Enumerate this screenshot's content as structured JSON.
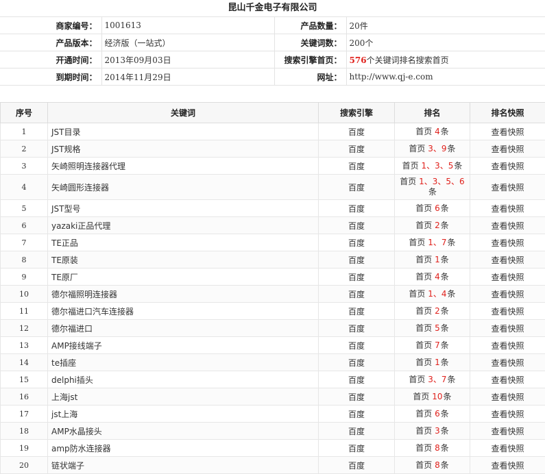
{
  "company": "昆山千金电子有限公司",
  "info": {
    "merchant_no_label": "商家编号：",
    "merchant_no": "1001613",
    "product_qty_label": "产品数量：",
    "product_qty": "20件",
    "version_label": "产品版本：",
    "version": "经济版（一站式）",
    "keyword_count_label": "关键词数：",
    "keyword_count": "200个",
    "open_label": "开通时间：",
    "open_date": "2013年09月03日",
    "search_label": "搜索引擎首页：",
    "search_count": "576",
    "search_suffix": "个关键词排名搜索首页",
    "expire_label": "到期时间：",
    "expire_date": "2014年11月29日",
    "url_label": "网址：",
    "url": "http://www.qj-e.com"
  },
  "table": {
    "headers": [
      "序号",
      "关键词",
      "搜索引擎",
      "排名",
      "排名快照"
    ],
    "rows": [
      {
        "no": "1",
        "keyword": "JST目录",
        "engine": "百度",
        "rank_prefix": "首页",
        "rank_nums": "4",
        "rank_suffix": "条",
        "snapshot": "查看快照"
      },
      {
        "no": "2",
        "keyword": "JST规格",
        "engine": "百度",
        "rank_prefix": "首页",
        "rank_nums": "3、9",
        "rank_suffix": "条",
        "snapshot": "查看快照"
      },
      {
        "no": "3",
        "keyword": "矢崎照明连接器代理",
        "engine": "百度",
        "rank_prefix": "首页",
        "rank_nums": "1、3、5",
        "rank_suffix": "条",
        "snapshot": "查看快照"
      },
      {
        "no": "4",
        "keyword": "矢崎圆形连接器",
        "engine": "百度",
        "rank_prefix": "首页",
        "rank_nums": "1、3、5、6",
        "rank_suffix": "条",
        "snapshot": "查看快照"
      },
      {
        "no": "5",
        "keyword": "JST型号",
        "engine": "百度",
        "rank_prefix": "首页",
        "rank_nums": "6",
        "rank_suffix": "条",
        "snapshot": "查看快照"
      },
      {
        "no": "6",
        "keyword": "yazaki正品代理",
        "engine": "百度",
        "rank_prefix": "首页",
        "rank_nums": "2",
        "rank_suffix": "条",
        "snapshot": "查看快照"
      },
      {
        "no": "7",
        "keyword": "TE正品",
        "engine": "百度",
        "rank_prefix": "首页",
        "rank_nums": "1、7",
        "rank_suffix": "条",
        "snapshot": "查看快照"
      },
      {
        "no": "8",
        "keyword": "TE原装",
        "engine": "百度",
        "rank_prefix": "首页",
        "rank_nums": "1",
        "rank_suffix": "条",
        "snapshot": "查看快照"
      },
      {
        "no": "9",
        "keyword": "TE原厂",
        "engine": "百度",
        "rank_prefix": "首页",
        "rank_nums": "4",
        "rank_suffix": "条",
        "snapshot": "查看快照"
      },
      {
        "no": "10",
        "keyword": "德尔福照明连接器",
        "engine": "百度",
        "rank_prefix": "首页",
        "rank_nums": "1、4",
        "rank_suffix": "条",
        "snapshot": "查看快照"
      },
      {
        "no": "11",
        "keyword": "德尔福进口汽车连接器",
        "engine": "百度",
        "rank_prefix": "首页",
        "rank_nums": "2",
        "rank_suffix": "条",
        "snapshot": "查看快照"
      },
      {
        "no": "12",
        "keyword": "德尔福进口",
        "engine": "百度",
        "rank_prefix": "首页",
        "rank_nums": "5",
        "rank_suffix": "条",
        "snapshot": "查看快照"
      },
      {
        "no": "13",
        "keyword": "AMP接线端子",
        "engine": "百度",
        "rank_prefix": "首页",
        "rank_nums": "7",
        "rank_suffix": "条",
        "snapshot": "查看快照"
      },
      {
        "no": "14",
        "keyword": "te插座",
        "engine": "百度",
        "rank_prefix": "首页",
        "rank_nums": "1",
        "rank_suffix": "条",
        "snapshot": "查看快照"
      },
      {
        "no": "15",
        "keyword": "delphi插头",
        "engine": "百度",
        "rank_prefix": "首页",
        "rank_nums": "3、7",
        "rank_suffix": "条",
        "snapshot": "查看快照"
      },
      {
        "no": "16",
        "keyword": "上海jst",
        "engine": "百度",
        "rank_prefix": "首页",
        "rank_nums": "10",
        "rank_suffix": "条",
        "snapshot": "查看快照"
      },
      {
        "no": "17",
        "keyword": "jst上海",
        "engine": "百度",
        "rank_prefix": "首页",
        "rank_nums": "6",
        "rank_suffix": "条",
        "snapshot": "查看快照"
      },
      {
        "no": "18",
        "keyword": "AMP水晶接头",
        "engine": "百度",
        "rank_prefix": "首页",
        "rank_nums": "3",
        "rank_suffix": "条",
        "snapshot": "查看快照"
      },
      {
        "no": "19",
        "keyword": "amp防水连接器",
        "engine": "百度",
        "rank_prefix": "首页",
        "rank_nums": "8",
        "rank_suffix": "条",
        "snapshot": "查看快照"
      },
      {
        "no": "20",
        "keyword": "链状端子",
        "engine": "百度",
        "rank_prefix": "首页",
        "rank_nums": "8",
        "rank_suffix": "条",
        "snapshot": "查看快照"
      }
    ]
  }
}
